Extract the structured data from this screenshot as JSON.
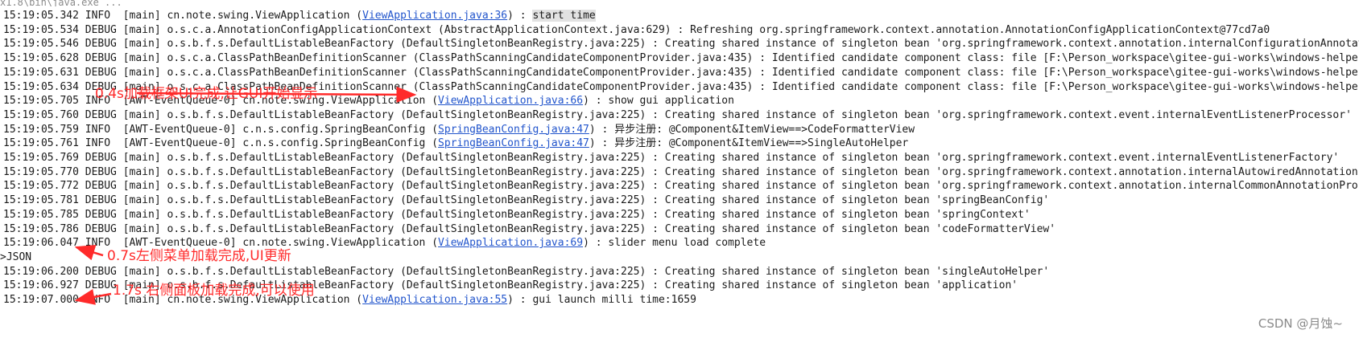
{
  "console_header": "x1.8\\bin\\java.exe ...",
  "log_lines": [
    {
      "pre": "15:19:05.342 INFO  [main] cn.note.swing.ViewApplication (",
      "link": "ViewApplication.java:36",
      "post": ") : ",
      "hl": "start time"
    },
    {
      "pre": "15:19:05.534 DEBUG [main] o.s.c.a.AnnotationConfigApplicationContext (AbstractApplicationContext.java:629) : Refreshing org.springframework.context.annotation.AnnotationConfigApplicationContext@77cd7a0"
    },
    {
      "pre": "15:19:05.546 DEBUG [main] o.s.b.f.s.DefaultListableBeanFactory (DefaultSingletonBeanRegistry.java:225) : Creating shared instance of singleton bean 'org.springframework.context.annotation.internalConfigurationAnnotationProcessor'"
    },
    {
      "pre": "15:19:05.628 DEBUG [main] o.s.c.a.ClassPathBeanDefinitionScanner (ClassPathScanningCandidateComponentProvider.java:435) : Identified candidate component class: file [F:\\Person_workspace\\gitee-gui-works\\windows-helper"
    },
    {
      "pre": "15:19:05.631 DEBUG [main] o.s.c.a.ClassPathBeanDefinitionScanner (ClassPathScanningCandidateComponentProvider.java:435) : Identified candidate component class: file [F:\\Person_workspace\\gitee-gui-works\\windows-helper"
    },
    {
      "pre": "15:19:05.634 DEBUG [main] o.s.c.a.ClassPathBeanDefinitionScanner (ClassPathScanningCandidateComponentProvider.java:435) : Identified candidate component class: file [F:\\Person_workspace\\gitee-gui-works\\windows-helper"
    },
    {
      "pre": "15:19:05.705 INFO  [AWT-EventQueue-0] cn.note.swing.ViewApplication (",
      "link": "ViewApplication.java:66",
      "post": ") : show gui application"
    },
    {
      "pre": "15:19:05.760 DEBUG [main] o.s.b.f.s.DefaultListableBeanFactory (DefaultSingletonBeanRegistry.java:225) : Creating shared instance of singleton bean 'org.springframework.context.event.internalEventListenerProcessor'"
    },
    {
      "pre": "15:19:05.759 INFO  [AWT-EventQueue-0] c.n.s.config.SpringBeanConfig (",
      "link": "SpringBeanConfig.java:47",
      "post": ") : 异步注册: @Component&ItemView==>CodeFormatterView"
    },
    {
      "pre": "15:19:05.761 INFO  [AWT-EventQueue-0] c.n.s.config.SpringBeanConfig (",
      "link": "SpringBeanConfig.java:47",
      "post": ") : 异步注册: @Component&ItemView==>SingleAutoHelper"
    },
    {
      "pre": "15:19:05.769 DEBUG [main] o.s.b.f.s.DefaultListableBeanFactory (DefaultSingletonBeanRegistry.java:225) : Creating shared instance of singleton bean 'org.springframework.context.event.internalEventListenerFactory'"
    },
    {
      "pre": "15:19:05.770 DEBUG [main] o.s.b.f.s.DefaultListableBeanFactory (DefaultSingletonBeanRegistry.java:225) : Creating shared instance of singleton bean 'org.springframework.context.annotation.internalAutowiredAnnotationProcessor'"
    },
    {
      "pre": "15:19:05.772 DEBUG [main] o.s.b.f.s.DefaultListableBeanFactory (DefaultSingletonBeanRegistry.java:225) : Creating shared instance of singleton bean 'org.springframework.context.annotation.internalCommonAnnotationProcessor'"
    },
    {
      "pre": "15:19:05.781 DEBUG [main] o.s.b.f.s.DefaultListableBeanFactory (DefaultSingletonBeanRegistry.java:225) : Creating shared instance of singleton bean 'springBeanConfig'"
    },
    {
      "pre": "15:19:05.785 DEBUG [main] o.s.b.f.s.DefaultListableBeanFactory (DefaultSingletonBeanRegistry.java:225) : Creating shared instance of singleton bean 'springContext'"
    },
    {
      "pre": "15:19:05.786 DEBUG [main] o.s.b.f.s.DefaultListableBeanFactory (DefaultSingletonBeanRegistry.java:225) : Creating shared instance of singleton bean 'codeFormatterView'"
    },
    {
      "pre": "15:19:06.047 INFO  [AWT-EventQueue-0] cn.note.swing.ViewApplication (",
      "link": "ViewApplication.java:69",
      "post": ") : slider menu load complete"
    },
    {
      "pre": ">JSON",
      "json": true
    },
    {
      "pre": "15:19:06.200 DEBUG [main] o.s.b.f.s.DefaultListableBeanFactory (DefaultSingletonBeanRegistry.java:225) : Creating shared instance of singleton bean 'singleAutoHelper'"
    },
    {
      "pre": "15:19:06.927 DEBUG [main] o.s.b.f.s.DefaultListableBeanFactory (DefaultSingletonBeanRegistry.java:225) : Creating shared instance of singleton bean 'application'"
    },
    {
      "pre": "15:19:07.000 INFO  [main] cn.note.swing.ViewApplication (",
      "link": "ViewApplication.java:55",
      "post": ") : gui launch milli time:1659"
    }
  ],
  "annotations": {
    "gui_start": "0.4s加载框架UI完成,让GUI开始显示",
    "menu_loaded": "0.7s左侧菜单加载完成,UI更新",
    "panel_loaded": "1.7s 右侧面板加载完成,可以使用"
  },
  "colors": {
    "annotation": "#ff2a2a",
    "link": "#2255cc",
    "highlight_bg": "#e2e2e2"
  },
  "watermark": "CSDN @月蚀~"
}
